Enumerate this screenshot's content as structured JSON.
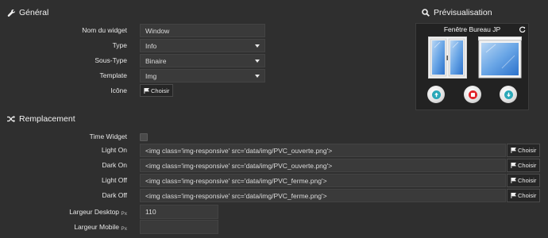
{
  "general": {
    "title": "Général",
    "fields": [
      {
        "label": "Nom du widget",
        "value": "Window"
      },
      {
        "label": "Type",
        "value": "Info"
      },
      {
        "label": "Sous-Type",
        "value": "Binaire"
      },
      {
        "label": "Template",
        "value": "Img"
      }
    ],
    "icon_label": "Icône",
    "choose_label": "Choisir"
  },
  "preview": {
    "title": "Prévisualisation",
    "widget_name": "Fenêtre Bureau JP",
    "icons": [
      "refresh-icon",
      "window-open-image",
      "window-closed-image",
      "up-button",
      "stop-button",
      "down-button"
    ]
  },
  "replacement": {
    "title": "Remplacement",
    "time_widget_label": "Time Widget",
    "rows": [
      {
        "label": "Light On",
        "value": "<img class='img-responsive' src='data/img/PVC_ouverte.png'>"
      },
      {
        "label": "Dark On",
        "value": "<img class='img-responsive' src='data/img/PVC_ouverte.png'>"
      },
      {
        "label": "Light Off",
        "value": "<img class='img-responsive' src='data/img/PVC_ferme.png'>"
      },
      {
        "label": "Dark Off",
        "value": "<img class='img-responsive' src='data/img/PVC_ferme.png'>"
      }
    ],
    "choose_label": "Choisir",
    "largeur_desktop_label": "Largeur Desktop",
    "largeur_desktop_unit": "Px",
    "largeur_desktop_value": "110",
    "largeur_mobile_label": "Largeur Mobile",
    "largeur_mobile_unit": "Px",
    "largeur_mobile_value": ""
  },
  "colors": {
    "background": "#2f2f2f",
    "field": "#3a3a3a",
    "up": "#2aa8b8",
    "stop": "#e0242a",
    "down": "#2aa8b8"
  }
}
